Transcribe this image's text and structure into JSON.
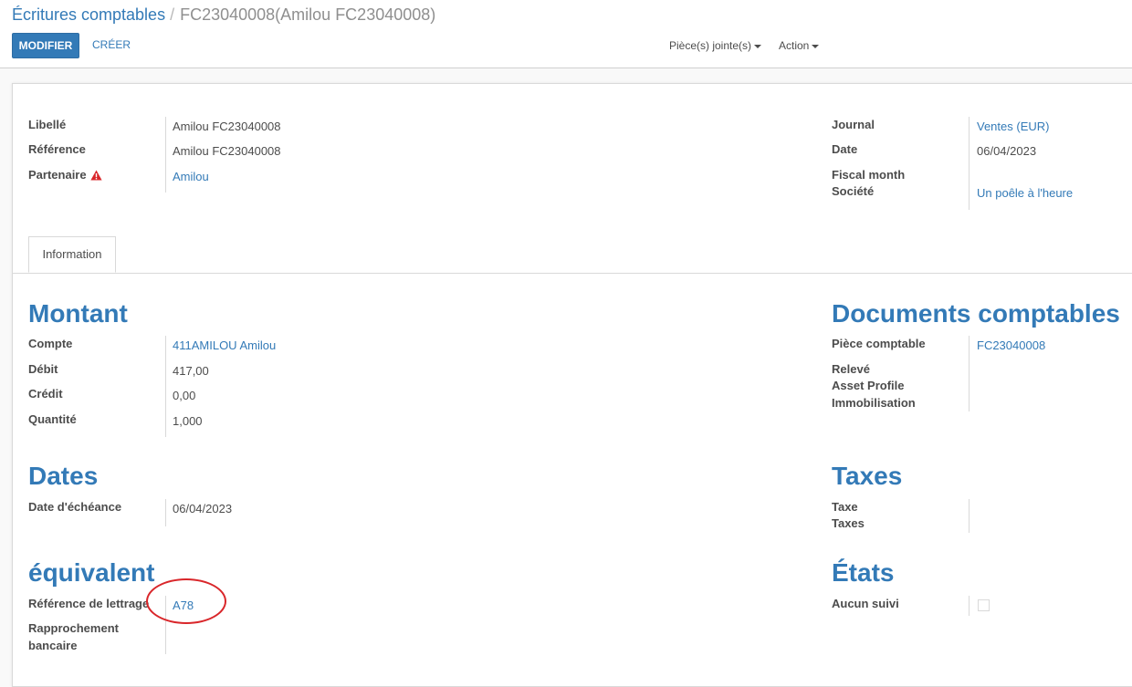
{
  "breadcrumb": {
    "root": "Écritures comptables",
    "separator": "/",
    "current": "FC23040008(Amilou FC23040008)"
  },
  "toolbar": {
    "edit_label": "MODIFIER",
    "create_label": "CRÉER",
    "attachments_label": "Pièce(s) jointe(s)",
    "action_label": "Action"
  },
  "header_left": {
    "libelle_label": "Libellé",
    "libelle_value": "Amilou FC23040008",
    "reference_label": "Référence",
    "reference_value": "Amilou FC23040008",
    "partner_label": "Partenaire",
    "partner_value": "Amilou"
  },
  "header_right": {
    "journal_label": "Journal",
    "journal_value": "Ventes (EUR)",
    "date_label": "Date",
    "date_value": "06/04/2023",
    "fiscal_month_label": "Fiscal month",
    "company_label": "Société",
    "company_value": "Un poêle à l'heure"
  },
  "tabs": [
    {
      "label": "Information"
    }
  ],
  "montant": {
    "title": "Montant",
    "compte_label": "Compte",
    "compte_value": "411AMILOU Amilou",
    "debit_label": "Débit",
    "debit_value": "417,00",
    "credit_label": "Crédit",
    "credit_value": "0,00",
    "quantite_label": "Quantité",
    "quantite_value": "1,000"
  },
  "documents": {
    "title": "Documents comptables",
    "piece_label": "Pièce comptable",
    "piece_value": "FC23040008",
    "releve_label": "Relevé",
    "asset_profile_label": "Asset Profile",
    "immobilisation_label": "Immobilisation"
  },
  "dates": {
    "title": "Dates",
    "echeance_label": "Date d'échéance",
    "echeance_value": "06/04/2023"
  },
  "taxes": {
    "title": "Taxes",
    "taxe_label": "Taxe",
    "taxes_label": "Taxes"
  },
  "equivalent": {
    "title": "équivalent",
    "lettrage_label": "Référence de lettrage",
    "lettrage_value": "A78",
    "rapprochement_label_1": "Rapprochement",
    "rapprochement_label_2": "bancaire"
  },
  "etats": {
    "title": "États",
    "suivi_label": "Aucun suivi",
    "suivi_checked": false
  },
  "colors": {
    "primary": "#337ab7",
    "warning": "#d9262a",
    "annotation": "#d9262a"
  }
}
